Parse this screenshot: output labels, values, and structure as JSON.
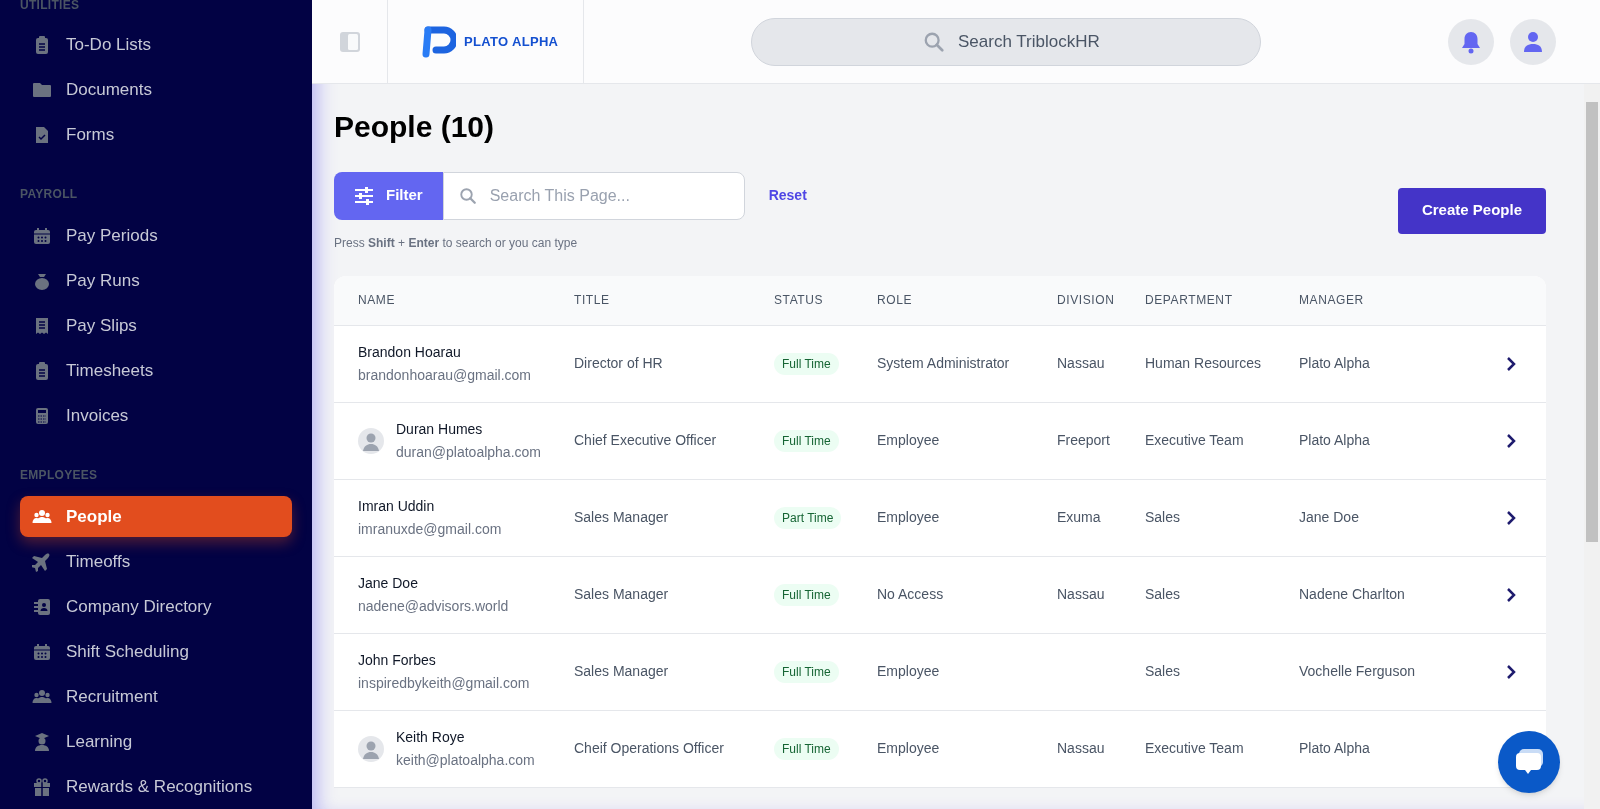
{
  "sidebar": {
    "sections": [
      {
        "heading": "UTILITIES",
        "items": [
          {
            "label": "To-Do Lists",
            "selected": false
          },
          {
            "label": "Documents",
            "selected": false
          },
          {
            "label": "Forms",
            "selected": false
          }
        ]
      },
      {
        "heading": "PAYROLL",
        "items": [
          {
            "label": "Pay Periods",
            "selected": false
          },
          {
            "label": "Pay Runs",
            "selected": false
          },
          {
            "label": "Pay Slips",
            "selected": false
          },
          {
            "label": "Timesheets",
            "selected": false
          },
          {
            "label": "Invoices",
            "selected": false
          }
        ]
      },
      {
        "heading": "EMPLOYEES",
        "items": [
          {
            "label": "People",
            "selected": true
          },
          {
            "label": "Timeoffs",
            "selected": false
          },
          {
            "label": "Company Directory",
            "selected": false
          },
          {
            "label": "Shift Scheduling",
            "selected": false
          },
          {
            "label": "Recruitment",
            "selected": false
          },
          {
            "label": "Learning",
            "selected": false
          },
          {
            "label": "Rewards & Recognitions",
            "selected": false
          }
        ]
      }
    ]
  },
  "header": {
    "logo_text": "PLATO ALPHA",
    "search": {
      "placeholder": "Search TriblockHR"
    }
  },
  "page": {
    "title": "People (10)",
    "filter_button": "Filter",
    "search": {
      "placeholder": "Search This Page..."
    },
    "reset_link": "Reset",
    "hint": "Press **Shift** + **Enter** to search or you can type",
    "create_button": "Create People"
  },
  "table": {
    "columns": [
      "NAME",
      "TITLE",
      "STATUS",
      "ROLE",
      "DIVISION",
      "DEPARTMENT",
      "MANAGER"
    ],
    "rows": [
      {
        "name": "Brandon Hoarau",
        "email": "brandonhoarau@gmail.com",
        "has_photo": false,
        "title": "Director of HR",
        "status": "Full Time",
        "role": "System Administrator",
        "division": "Nassau",
        "department": "Human Resources",
        "manager": "Plato Alpha"
      },
      {
        "name": "Duran Humes",
        "email": "duran@platoalpha.com",
        "has_photo": true,
        "title": "Chief Executive Officer",
        "status": "Full Time",
        "role": "Employee",
        "division": "Freeport",
        "department": "Executive Team",
        "manager": "Plato Alpha"
      },
      {
        "name": "Imran Uddin",
        "email": "imranuxde@gmail.com",
        "has_photo": false,
        "title": "Sales Manager",
        "status": "Part Time",
        "role": "Employee",
        "division": "Exuma",
        "department": "Sales",
        "manager": "Jane Doe"
      },
      {
        "name": "Jane Doe",
        "email": "nadene@advisors.world",
        "has_photo": false,
        "title": "Sales Manager",
        "status": "Full Time",
        "role": "No Access",
        "division": "Nassau",
        "department": "Sales",
        "manager": "Nadene Charlton"
      },
      {
        "name": "John Forbes",
        "email": "inspiredbykeith@gmail.com",
        "has_photo": false,
        "title": "Sales Manager",
        "status": "Full Time",
        "role": "Employee",
        "department": "Sales",
        "manager": "Vochelle Ferguson"
      },
      {
        "name": "Keith Roye",
        "email": "keith@platoalpha.com",
        "has_photo": true,
        "title": "Cheif Operations Officer",
        "status": "Full Time",
        "role": "Employee",
        "division": "Nassau",
        "department": "Executive Team",
        "manager": "Plato Alpha"
      }
    ]
  }
}
